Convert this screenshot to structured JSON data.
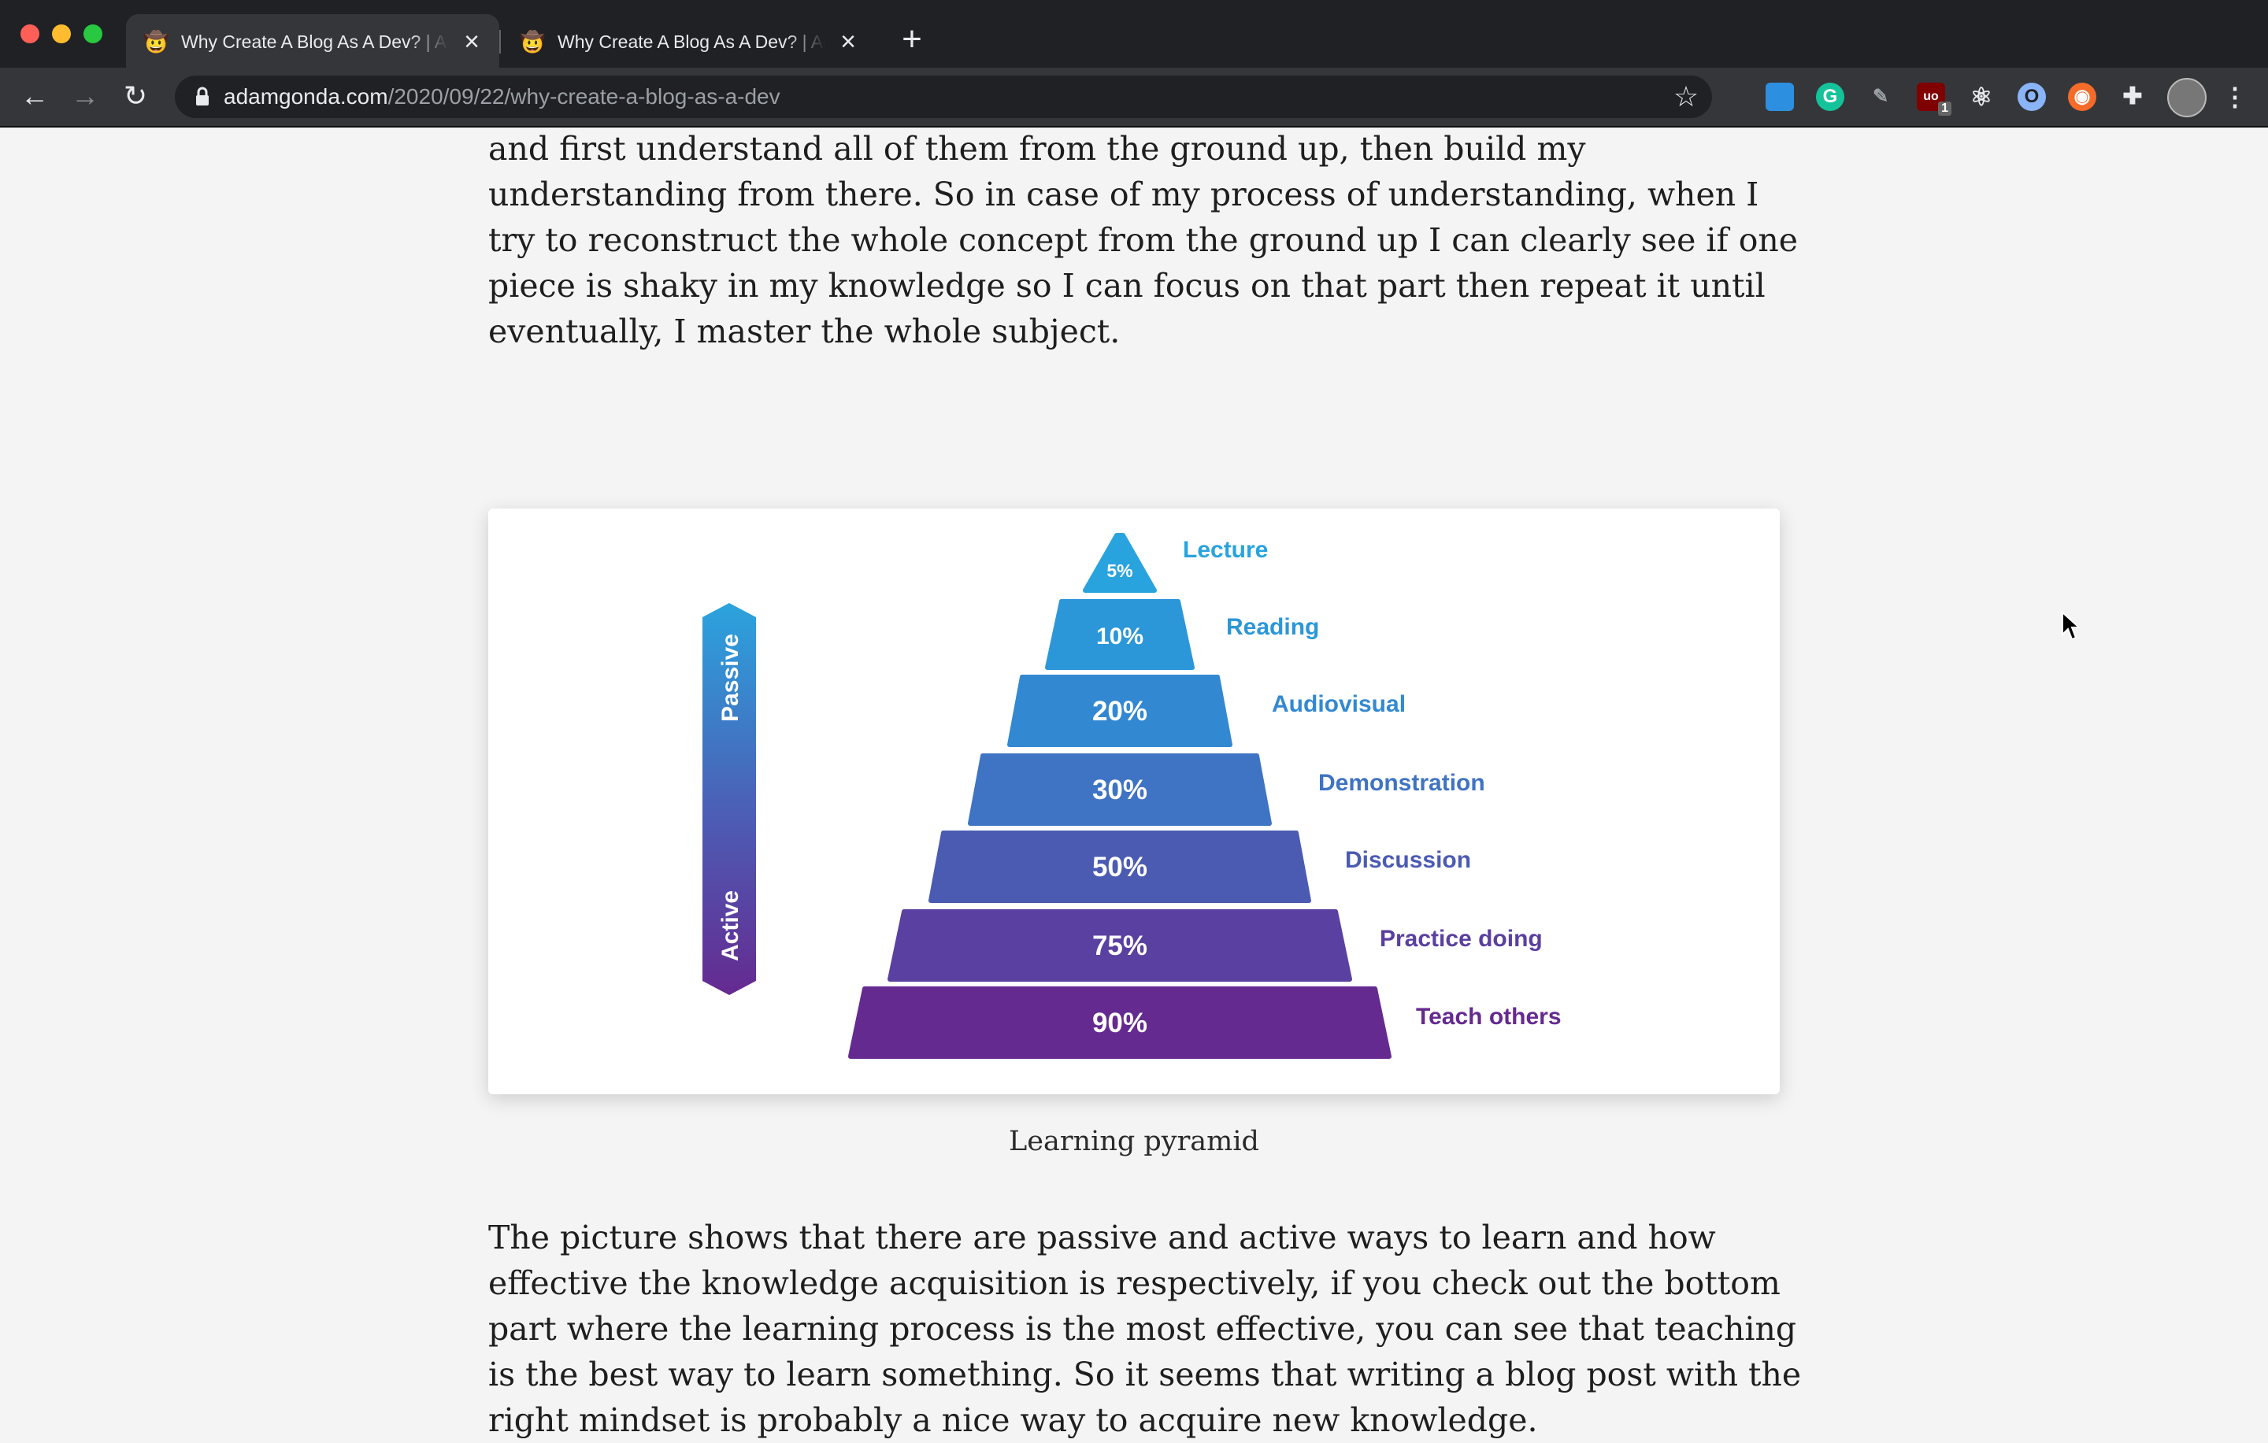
{
  "browser": {
    "tabs": [
      {
        "title": "Why Create A Blog As A Dev? | Adam Gonda",
        "favicon": "cowboy-emoji-icon",
        "active": true
      },
      {
        "title": "Why Create A Blog As A Dev? | Adam Gonda",
        "favicon": "cowboy-emoji-icon",
        "active": false
      }
    ],
    "address": {
      "host": "adamgonda.com",
      "path": "/2020/09/22/why-create-a-blog-as-a-dev"
    },
    "extensions": [
      "toolbar-square-icon",
      "grammarly-icon",
      "pen-icon",
      "ublock-icon",
      "react-devtools-icon",
      "circle-ext-icon",
      "orange-ext-icon",
      "puzzle-icon",
      "profile-avatar",
      "menu-icon"
    ],
    "ublock_badge": "1"
  },
  "article": {
    "para1_lines": [
      "and first understand all of them from the ground up, then build my",
      "understanding from there. So in case of my process of understanding, when I",
      "try to reconstruct the whole concept from the ground up I can clearly see if one",
      "piece is shaky in my knowledge so I can focus on that part then repeat it until",
      "eventually, I master the whole subject."
    ],
    "caption": "Learning pyramid",
    "para2_lines": [
      "The picture shows that there are passive and active ways to learn and how",
      "effective the knowledge acquisition is respectively, if you check out the bottom",
      "part where the learning process is the most effective, you can see that teaching",
      "is the best way to learn something. So it seems that writing a blog post with the",
      "right mindset is probably a nice way to acquire new knowledge."
    ]
  },
  "pyramid": {
    "axis_top": "Passive",
    "axis_bottom": "Active",
    "levels": [
      {
        "percent": "5%",
        "label": "Lecture",
        "color": "#29a3de"
      },
      {
        "percent": "10%",
        "label": "Reading",
        "color": "#2b97d9"
      },
      {
        "percent": "20%",
        "label": "Audiovisual",
        "color": "#3388d2"
      },
      {
        "percent": "30%",
        "label": "Demonstration",
        "color": "#3f73c3"
      },
      {
        "percent": "50%",
        "label": "Discussion",
        "color": "#4b5bb2"
      },
      {
        "percent": "75%",
        "label": "Practice doing",
        "color": "#5a40a0"
      },
      {
        "percent": "90%",
        "label": "Teach others",
        "color": "#652a90"
      }
    ]
  }
}
